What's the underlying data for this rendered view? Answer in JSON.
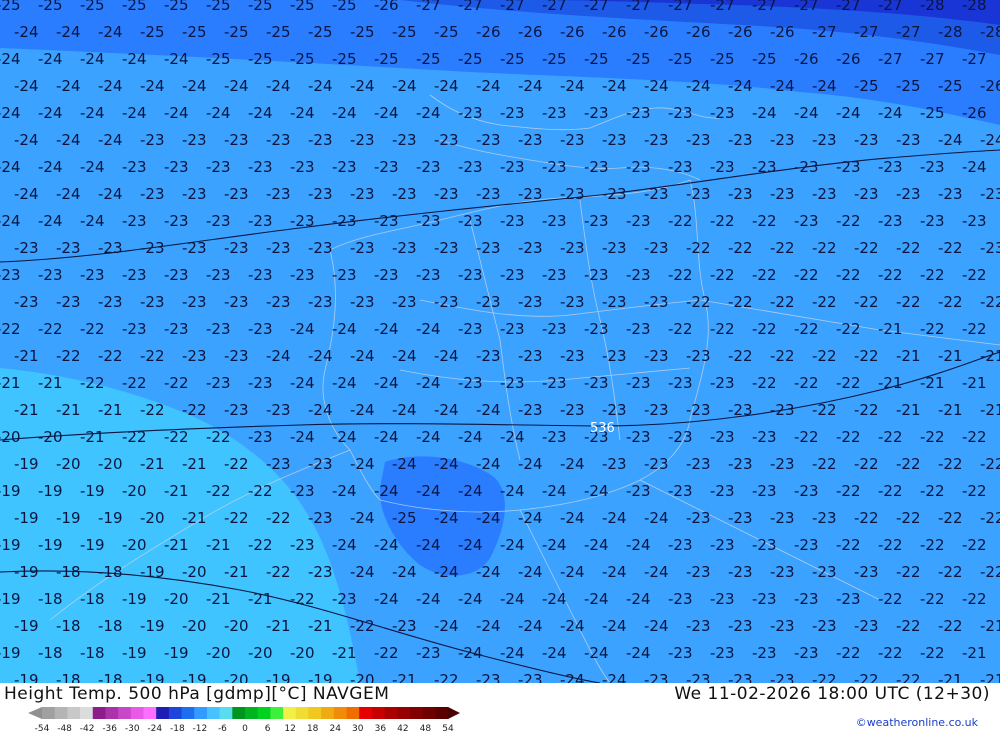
{
  "header": {
    "title": "Height Temp. 500 hPa [gdmp][°C] NAVGEM",
    "datetime": "We 11-02-2026 18:00 UTC (12+30)",
    "credit": "©weatheronline.co.uk"
  },
  "contour_label": "536",
  "legend": {
    "ticks": [
      "-54",
      "-48",
      "-42",
      "-36",
      "-30",
      "-24",
      "-18",
      "-12",
      "-6",
      "0",
      "6",
      "12",
      "18",
      "24",
      "30",
      "36",
      "42",
      "48",
      "54"
    ],
    "colors": [
      "#a0a0a0",
      "#b4b4b4",
      "#c8c8c8",
      "#dcdcdc",
      "#8c1e8c",
      "#aa32aa",
      "#c846c8",
      "#e65ae6",
      "#ff6eff",
      "#1e1eb4",
      "#1e46dc",
      "#1e6ef0",
      "#329bff",
      "#46c3ff",
      "#5adcf0",
      "#00961e",
      "#00b41e",
      "#00d21e",
      "#3cf03c",
      "#f0f046",
      "#f0dc32",
      "#f0c81e",
      "#f0aa14",
      "#f08c0a",
      "#f06e00",
      "#e60000",
      "#c80000",
      "#aa0000",
      "#960000",
      "#820000",
      "#6e0000",
      "#5a0000"
    ]
  },
  "map": {
    "label_rows": [
      {
        "n": [
          25,
          25,
          25,
          25,
          25,
          25,
          25,
          25,
          25,
          26,
          27,
          27,
          27,
          27,
          27,
          27,
          27,
          27,
          27,
          27,
          27,
          27,
          28,
          28,
          28
        ]
      },
      {
        "n": [
          24,
          24,
          24,
          25,
          25,
          25,
          25,
          25,
          25,
          25,
          25,
          26,
          26,
          26,
          26,
          26,
          26,
          26,
          26,
          27,
          27,
          27,
          28,
          28,
          28
        ]
      },
      {
        "n": [
          24,
          24,
          24,
          24,
          24,
          25,
          25,
          25,
          25,
          25,
          25,
          25,
          25,
          25,
          25,
          25,
          25,
          25,
          25,
          26,
          26,
          27,
          27,
          27
        ]
      },
      {
        "n": [
          24,
          24,
          24,
          24,
          24,
          24,
          24,
          24,
          24,
          24,
          24,
          24,
          24,
          24,
          24,
          24,
          24,
          24,
          24,
          24,
          25,
          25,
          25,
          26,
          26
        ]
      },
      {
        "n": [
          24,
          24,
          24,
          24,
          24,
          24,
          24,
          24,
          24,
          24,
          24,
          23,
          23,
          23,
          23,
          23,
          23,
          23,
          24,
          24,
          24,
          24,
          25,
          26
        ]
      },
      {
        "n": [
          24,
          24,
          24,
          23,
          23,
          23,
          23,
          23,
          23,
          23,
          23,
          23,
          23,
          23,
          23,
          23,
          23,
          23,
          23,
          23,
          23,
          23,
          24,
          24,
          25
        ]
      },
      {
        "n": [
          24,
          24,
          24,
          23,
          23,
          23,
          23,
          23,
          23,
          23,
          23,
          23,
          23,
          23,
          23,
          23,
          23,
          23,
          23,
          23,
          23,
          23,
          23,
          24,
          24
        ]
      },
      {
        "n": [
          24,
          24,
          24,
          23,
          23,
          23,
          23,
          23,
          23,
          23,
          23,
          23,
          23,
          23,
          23,
          23,
          23,
          23,
          23,
          23,
          23,
          23,
          23,
          23,
          23
        ]
      },
      {
        "n": [
          24,
          24,
          24,
          23,
          23,
          23,
          23,
          23,
          23,
          23,
          23,
          23,
          23,
          23,
          23,
          23,
          22,
          22,
          22,
          23,
          22,
          23,
          23,
          23,
          23
        ]
      },
      {
        "n": [
          23,
          23,
          23,
          23,
          23,
          23,
          23,
          23,
          23,
          23,
          23,
          23,
          23,
          23,
          23,
          23,
          22,
          22,
          22,
          22,
          22,
          22,
          22,
          23,
          23
        ]
      },
      {
        "n": [
          23,
          23,
          23,
          23,
          23,
          23,
          23,
          23,
          23,
          23,
          23,
          23,
          23,
          23,
          23,
          23,
          22,
          22,
          22,
          22,
          22,
          22,
          22,
          22,
          22
        ]
      },
      {
        "n": [
          23,
          23,
          23,
          23,
          23,
          23,
          23,
          23,
          23,
          23,
          23,
          23,
          23,
          23,
          23,
          23,
          22,
          22,
          22,
          22,
          22,
          22,
          22,
          22,
          22
        ]
      },
      {
        "n": [
          22,
          22,
          22,
          23,
          23,
          23,
          23,
          24,
          24,
          24,
          24,
          23,
          23,
          23,
          23,
          23,
          22,
          22,
          22,
          22,
          22,
          21,
          22,
          22,
          22
        ]
      },
      {
        "n": [
          21,
          22,
          22,
          22,
          23,
          23,
          24,
          24,
          24,
          24,
          24,
          23,
          23,
          23,
          23,
          23,
          23,
          22,
          22,
          22,
          22,
          21,
          21,
          21,
          21
        ]
      },
      {
        "n": [
          21,
          21,
          22,
          22,
          22,
          23,
          23,
          24,
          24,
          24,
          24,
          23,
          23,
          23,
          23,
          23,
          23,
          23,
          22,
          22,
          22,
          21,
          21,
          21,
          21
        ]
      },
      {
        "n": [
          21,
          21,
          21,
          22,
          22,
          23,
          23,
          24,
          24,
          24,
          24,
          24,
          23,
          23,
          23,
          23,
          23,
          23,
          23,
          22,
          22,
          21,
          21,
          21,
          21
        ]
      },
      {
        "n": [
          20,
          20,
          21,
          22,
          22,
          22,
          23,
          24,
          24,
          24,
          24,
          24,
          24,
          23,
          23,
          23,
          23,
          23,
          23,
          22,
          22,
          22,
          22,
          22,
          22
        ]
      },
      {
        "n": [
          19,
          20,
          20,
          21,
          21,
          22,
          23,
          23,
          24,
          24,
          24,
          24,
          24,
          24,
          23,
          23,
          23,
          23,
          23,
          22,
          22,
          22,
          22,
          22,
          22
        ]
      },
      {
        "n": [
          19,
          19,
          19,
          20,
          21,
          22,
          22,
          23,
          24,
          24,
          24,
          24,
          24,
          24,
          24,
          23,
          23,
          23,
          23,
          23,
          22,
          22,
          22,
          22,
          22
        ]
      },
      {
        "n": [
          19,
          19,
          19,
          20,
          21,
          22,
          22,
          23,
          24,
          25,
          24,
          24,
          24,
          24,
          24,
          24,
          23,
          23,
          23,
          23,
          22,
          22,
          22,
          22,
          22
        ]
      },
      {
        "n": [
          19,
          19,
          19,
          20,
          21,
          21,
          22,
          23,
          24,
          24,
          24,
          24,
          24,
          24,
          24,
          24,
          23,
          23,
          23,
          23,
          22,
          22,
          22,
          22,
          22
        ]
      },
      {
        "n": [
          19,
          18,
          18,
          19,
          20,
          21,
          22,
          23,
          24,
          24,
          24,
          24,
          24,
          24,
          24,
          24,
          23,
          23,
          23,
          23,
          23,
          22,
          22,
          22,
          22
        ]
      },
      {
        "n": [
          19,
          18,
          18,
          19,
          20,
          21,
          21,
          22,
          23,
          24,
          24,
          24,
          24,
          24,
          24,
          24,
          23,
          23,
          23,
          23,
          23,
          22,
          22,
          22,
          22
        ]
      },
      {
        "n": [
          19,
          18,
          18,
          19,
          20,
          20,
          21,
          21,
          22,
          23,
          24,
          24,
          24,
          24,
          24,
          24,
          23,
          23,
          23,
          23,
          23,
          22,
          22,
          21,
          21
        ]
      },
      {
        "n": [
          19,
          18,
          18,
          19,
          19,
          20,
          20,
          20,
          21,
          22,
          23,
          24,
          24,
          24,
          24,
          24,
          23,
          23,
          23,
          23,
          22,
          22,
          22,
          21,
          21
        ]
      },
      {
        "n": [
          19,
          18,
          18,
          19,
          19,
          20,
          19,
          19,
          20,
          21,
          22,
          23,
          23,
          24,
          24,
          23,
          23,
          23,
          23,
          22,
          22,
          22,
          21,
          21,
          21
        ]
      }
    ]
  }
}
